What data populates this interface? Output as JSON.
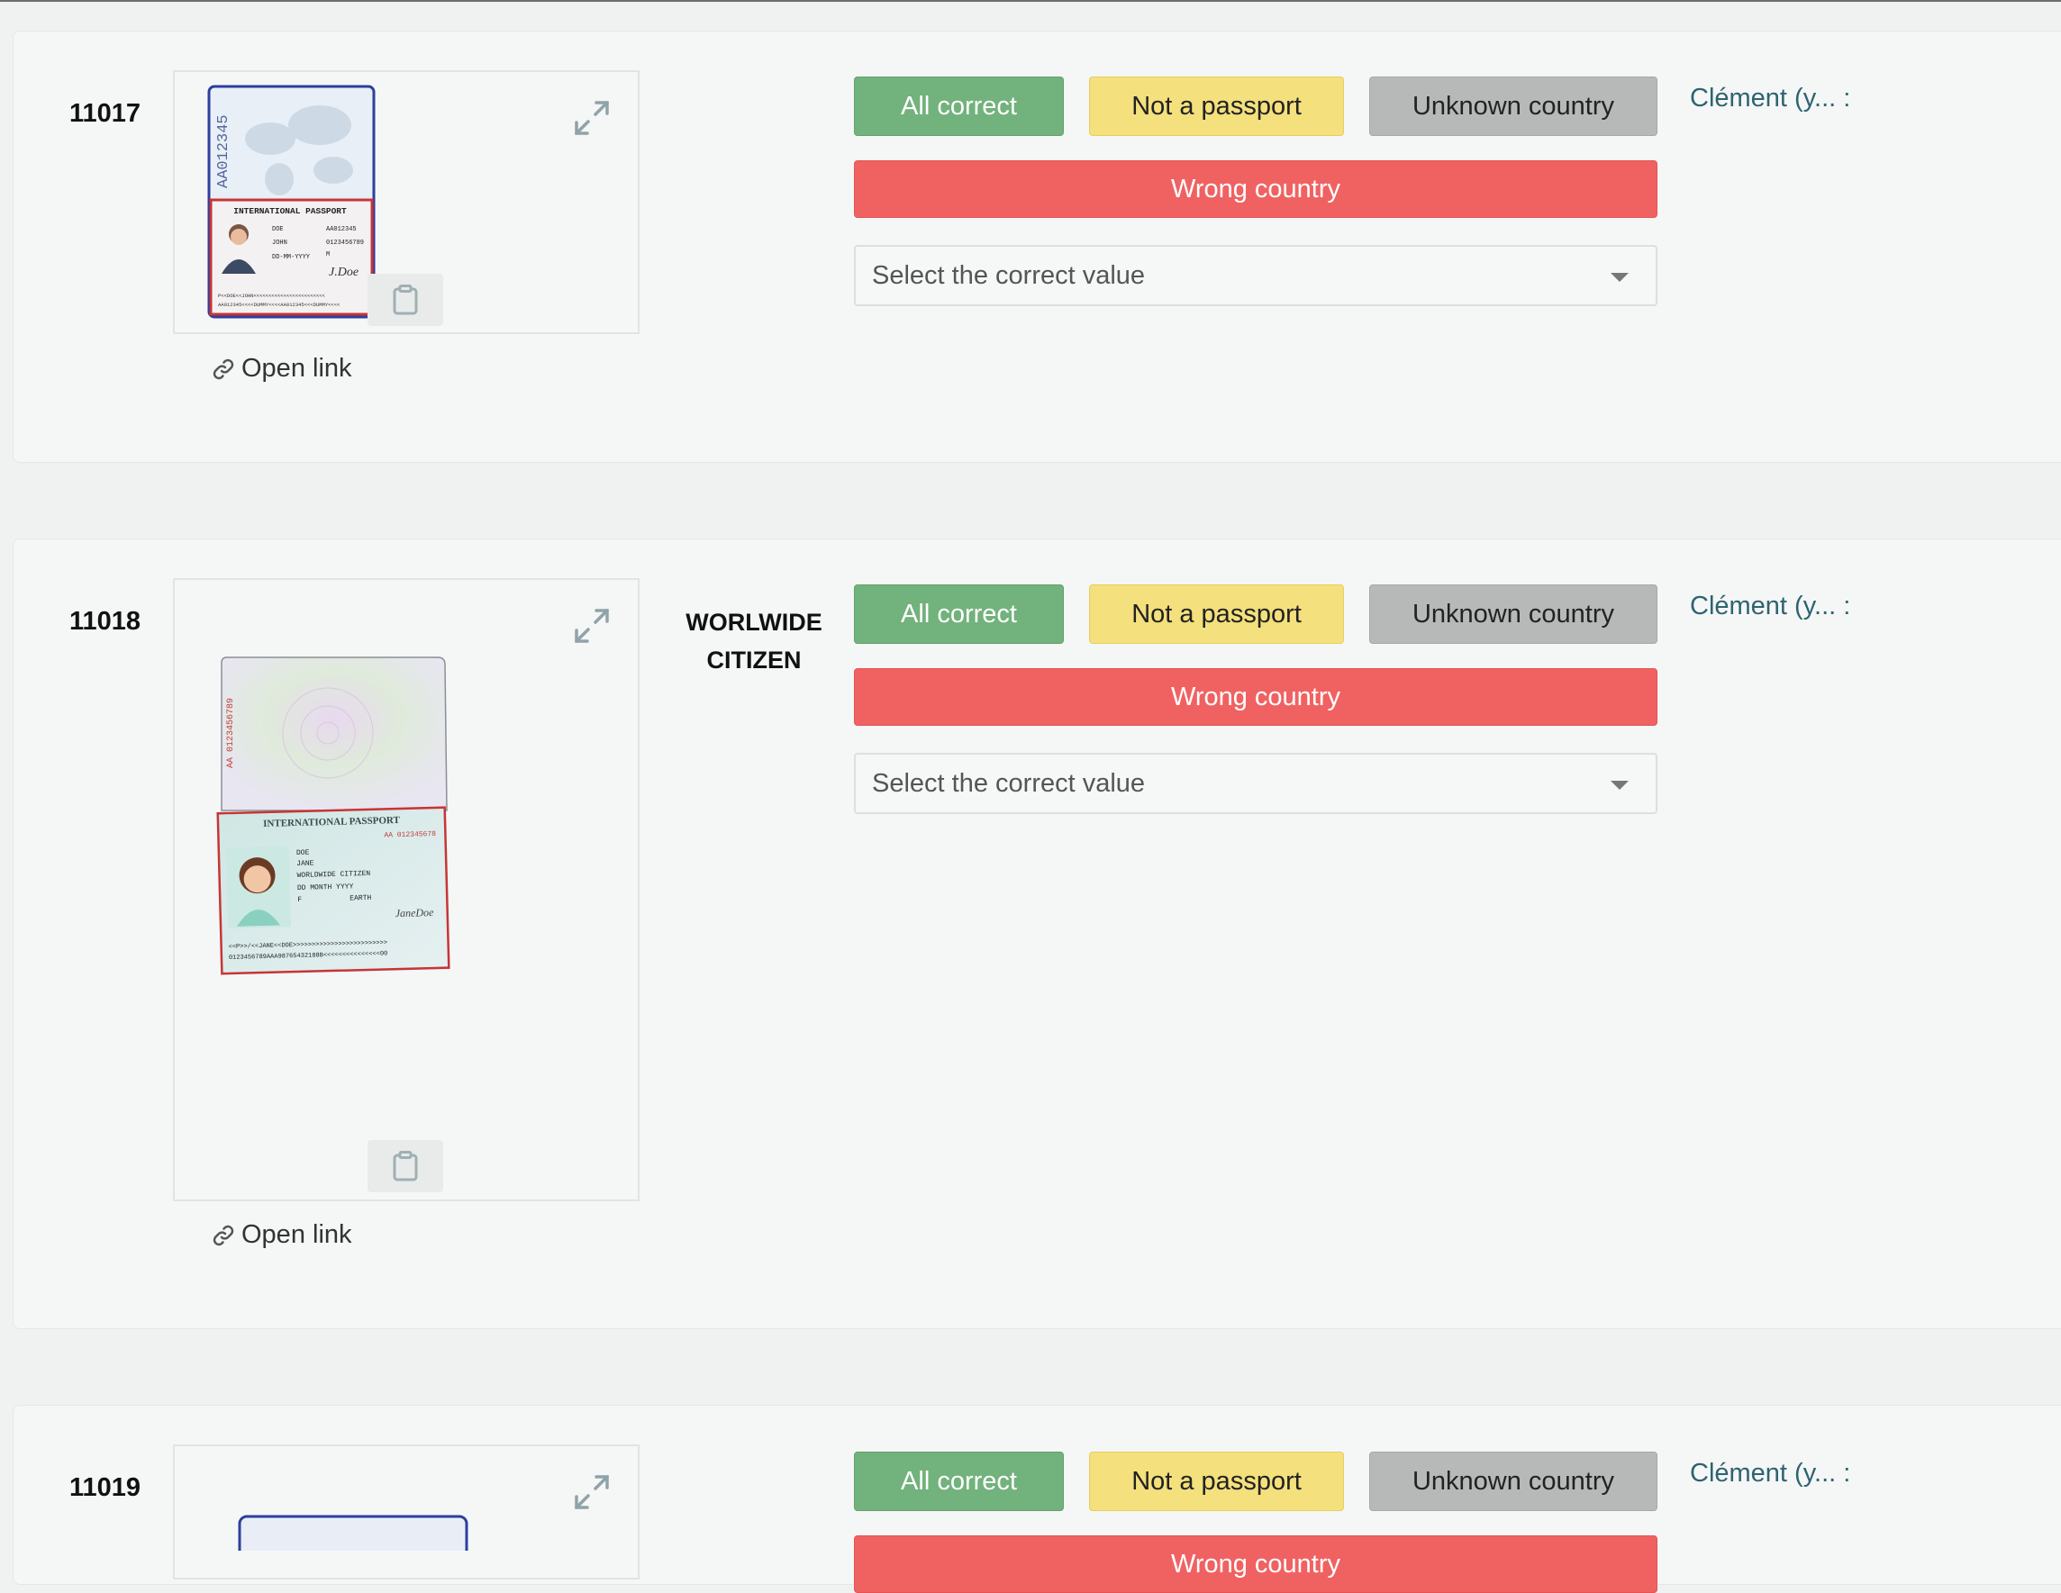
{
  "buttons": {
    "all_correct": "All correct",
    "not_passport": "Not a passport",
    "unknown_country": "Unknown country",
    "wrong_country": "Wrong country"
  },
  "select_placeholder": "Select the correct value",
  "open_link": "Open link",
  "reviewer": "Clément (y... :",
  "colors": {
    "green": "#72b27c",
    "yellow": "#f4e07c",
    "gray": "#b7b9b9",
    "red": "#f06262",
    "reviewer": "#2d6470"
  },
  "icons": [
    "expand-icon",
    "clipboard-icon",
    "link-icon",
    "chevron-down-icon"
  ],
  "records": [
    {
      "id": "11017",
      "detected_line1": "",
      "detected_line2": "",
      "passport": {
        "number_vertical": "AA012345",
        "header": "INTERNATIONAL PASSPORT",
        "surname": "DOE",
        "given_names": "JOHN",
        "passport_no": "AA012345",
        "personal_no": "0123456789",
        "sex": "M",
        "dob": "DD-MM-YYYY",
        "signature": "J.Doe",
        "mrz1": "P<<DOE<<JOHN<<<<<<<<<<<<<<<<<<<<<<<<",
        "mrz2": "AA012345<<<<DUMMY<<<<AA012345<<<DUMMY<<<<"
      }
    },
    {
      "id": "11018",
      "detected_line1": "WORLWIDE",
      "detected_line2": "CITIZEN",
      "passport": {
        "number_vertical": "AA 0123456789",
        "header": "INTERNATIONAL PASSPORT",
        "passport_no": "AA 012345678",
        "surname": "DOE",
        "given_names": "JANE",
        "nationality": "WORLDWIDE CITIZEN",
        "dob": "DD MONTH YYYY",
        "sex": "F",
        "place_of_birth": "EARTH",
        "signature": "JaneDoe",
        "mrz1": "<<P>>/<<JANE<<DOE>>>>>>>>>>>>>>>>>>>>>>>>>",
        "mrz2": "0123456789AAA98765432188B<<<<<<<<<<<<<<<00"
      }
    },
    {
      "id": "11019",
      "detected_line1": "",
      "detected_line2": ""
    }
  ]
}
